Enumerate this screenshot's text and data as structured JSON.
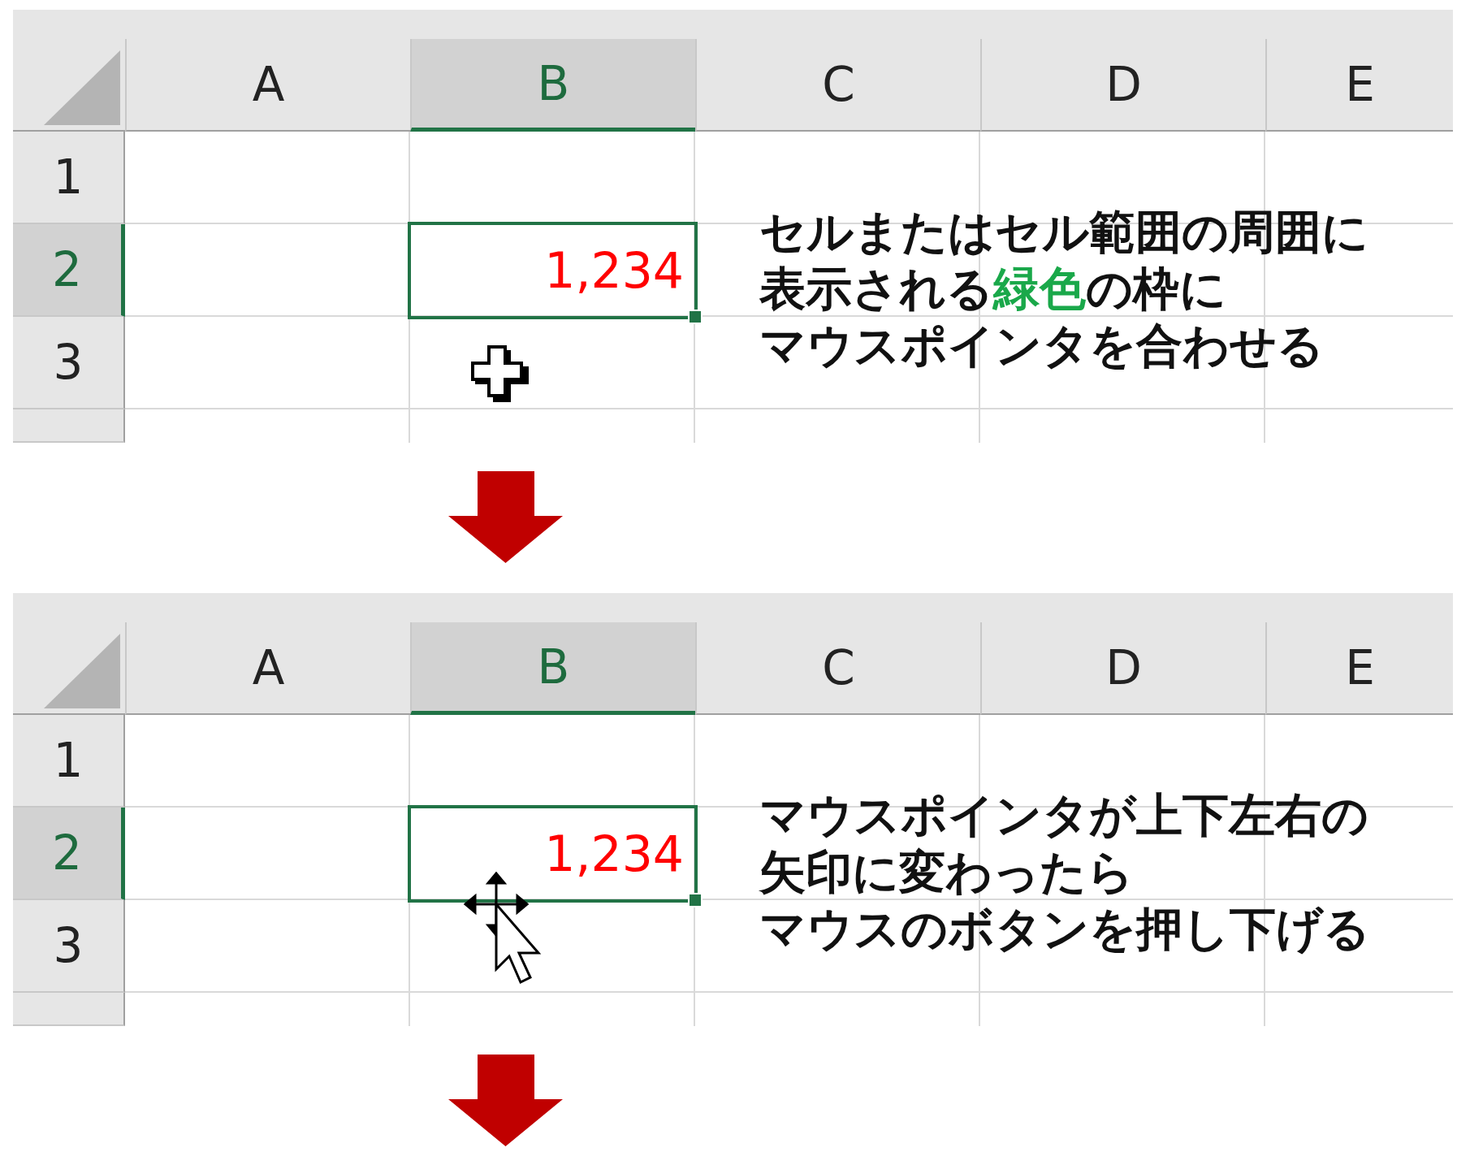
{
  "panels": [
    {
      "columns": [
        {
          "label": "A",
          "selected": false
        },
        {
          "label": "B",
          "selected": true
        },
        {
          "label": "C",
          "selected": false
        },
        {
          "label": "D",
          "selected": false
        },
        {
          "label": "E",
          "selected": false
        }
      ],
      "rows": [
        {
          "label": "1",
          "selected": false
        },
        {
          "label": "2",
          "selected": true
        },
        {
          "label": "3",
          "selected": false
        }
      ],
      "active_cell_value": "1,234",
      "pointer": {
        "kind": "cross"
      },
      "note": {
        "lines": [
          [
            {
              "text": "セルまたはセル範囲の周囲に",
              "highlight": false
            }
          ],
          [
            {
              "text": "表示される",
              "highlight": false
            },
            {
              "text": "緑色",
              "highlight": true
            },
            {
              "text": "の枠に",
              "highlight": false
            }
          ],
          [
            {
              "text": "マウスポインタを合わせる",
              "highlight": false
            }
          ]
        ]
      }
    },
    {
      "columns": [
        {
          "label": "A",
          "selected": false
        },
        {
          "label": "B",
          "selected": true
        },
        {
          "label": "C",
          "selected": false
        },
        {
          "label": "D",
          "selected": false
        },
        {
          "label": "E",
          "selected": false
        }
      ],
      "rows": [
        {
          "label": "1",
          "selected": false
        },
        {
          "label": "2",
          "selected": true
        },
        {
          "label": "3",
          "selected": false
        }
      ],
      "active_cell_value": "1,234",
      "pointer": {
        "kind": "move"
      },
      "note": {
        "lines": [
          [
            {
              "text": "マウスポインタが上下左右の",
              "highlight": false
            }
          ],
          [
            {
              "text": "矢印に変わったら",
              "highlight": false
            }
          ],
          [
            {
              "text": "マウスのボタンを押し下げる",
              "highlight": false
            }
          ]
        ]
      }
    }
  ]
}
